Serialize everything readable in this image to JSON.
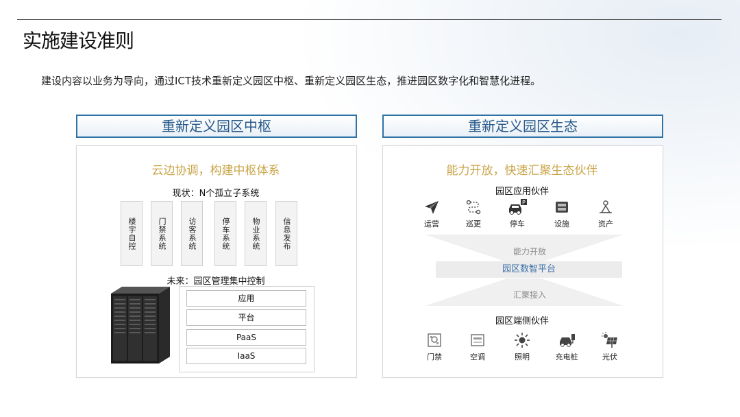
{
  "page": {
    "title": "实施建设准则",
    "subtitle": "建设内容以业务为导向，通过ICT技术重新定义园区中枢、重新定义园区生态，推进园区数字化和智慧化进程。"
  },
  "left": {
    "header": "重新定义园区中枢",
    "slogan": "云边协调，构建中枢体系",
    "status_label": "现状：N个孤立子系统",
    "systems": [
      "楼宇自控",
      "门禁系统",
      "访客系统",
      "停车系统",
      "物业系统",
      "信息发布"
    ],
    "future_label": "未来：园区管理集中控制",
    "stack": [
      "应用",
      "平台",
      "PaaS",
      "IaaS"
    ]
  },
  "right": {
    "header": "重新定义园区生态",
    "slogan": "能力开放，快速汇聚生态伙伴",
    "app_partners_label": "园区应用伙伴",
    "app_partners": [
      {
        "label": "运营",
        "icon": "paper-plane-icon"
      },
      {
        "label": "巡更",
        "icon": "patrol-route-icon"
      },
      {
        "label": "停车",
        "icon": "car-parking-icon"
      },
      {
        "label": "设施",
        "icon": "facility-icon"
      },
      {
        "label": "资产",
        "icon": "asset-icon"
      }
    ],
    "capability_open": "能力开放",
    "platform": "园区数智平台",
    "aggregation": "汇聚接入",
    "edge_partners_label": "园区端侧伙伴",
    "edge_partners": [
      {
        "label": "门禁",
        "icon": "access-control-icon"
      },
      {
        "label": "空调",
        "icon": "air-conditioner-icon"
      },
      {
        "label": "照明",
        "icon": "lighting-icon"
      },
      {
        "label": "充电桩",
        "icon": "charging-pile-icon"
      },
      {
        "label": "光伏",
        "icon": "solar-icon"
      }
    ]
  }
}
